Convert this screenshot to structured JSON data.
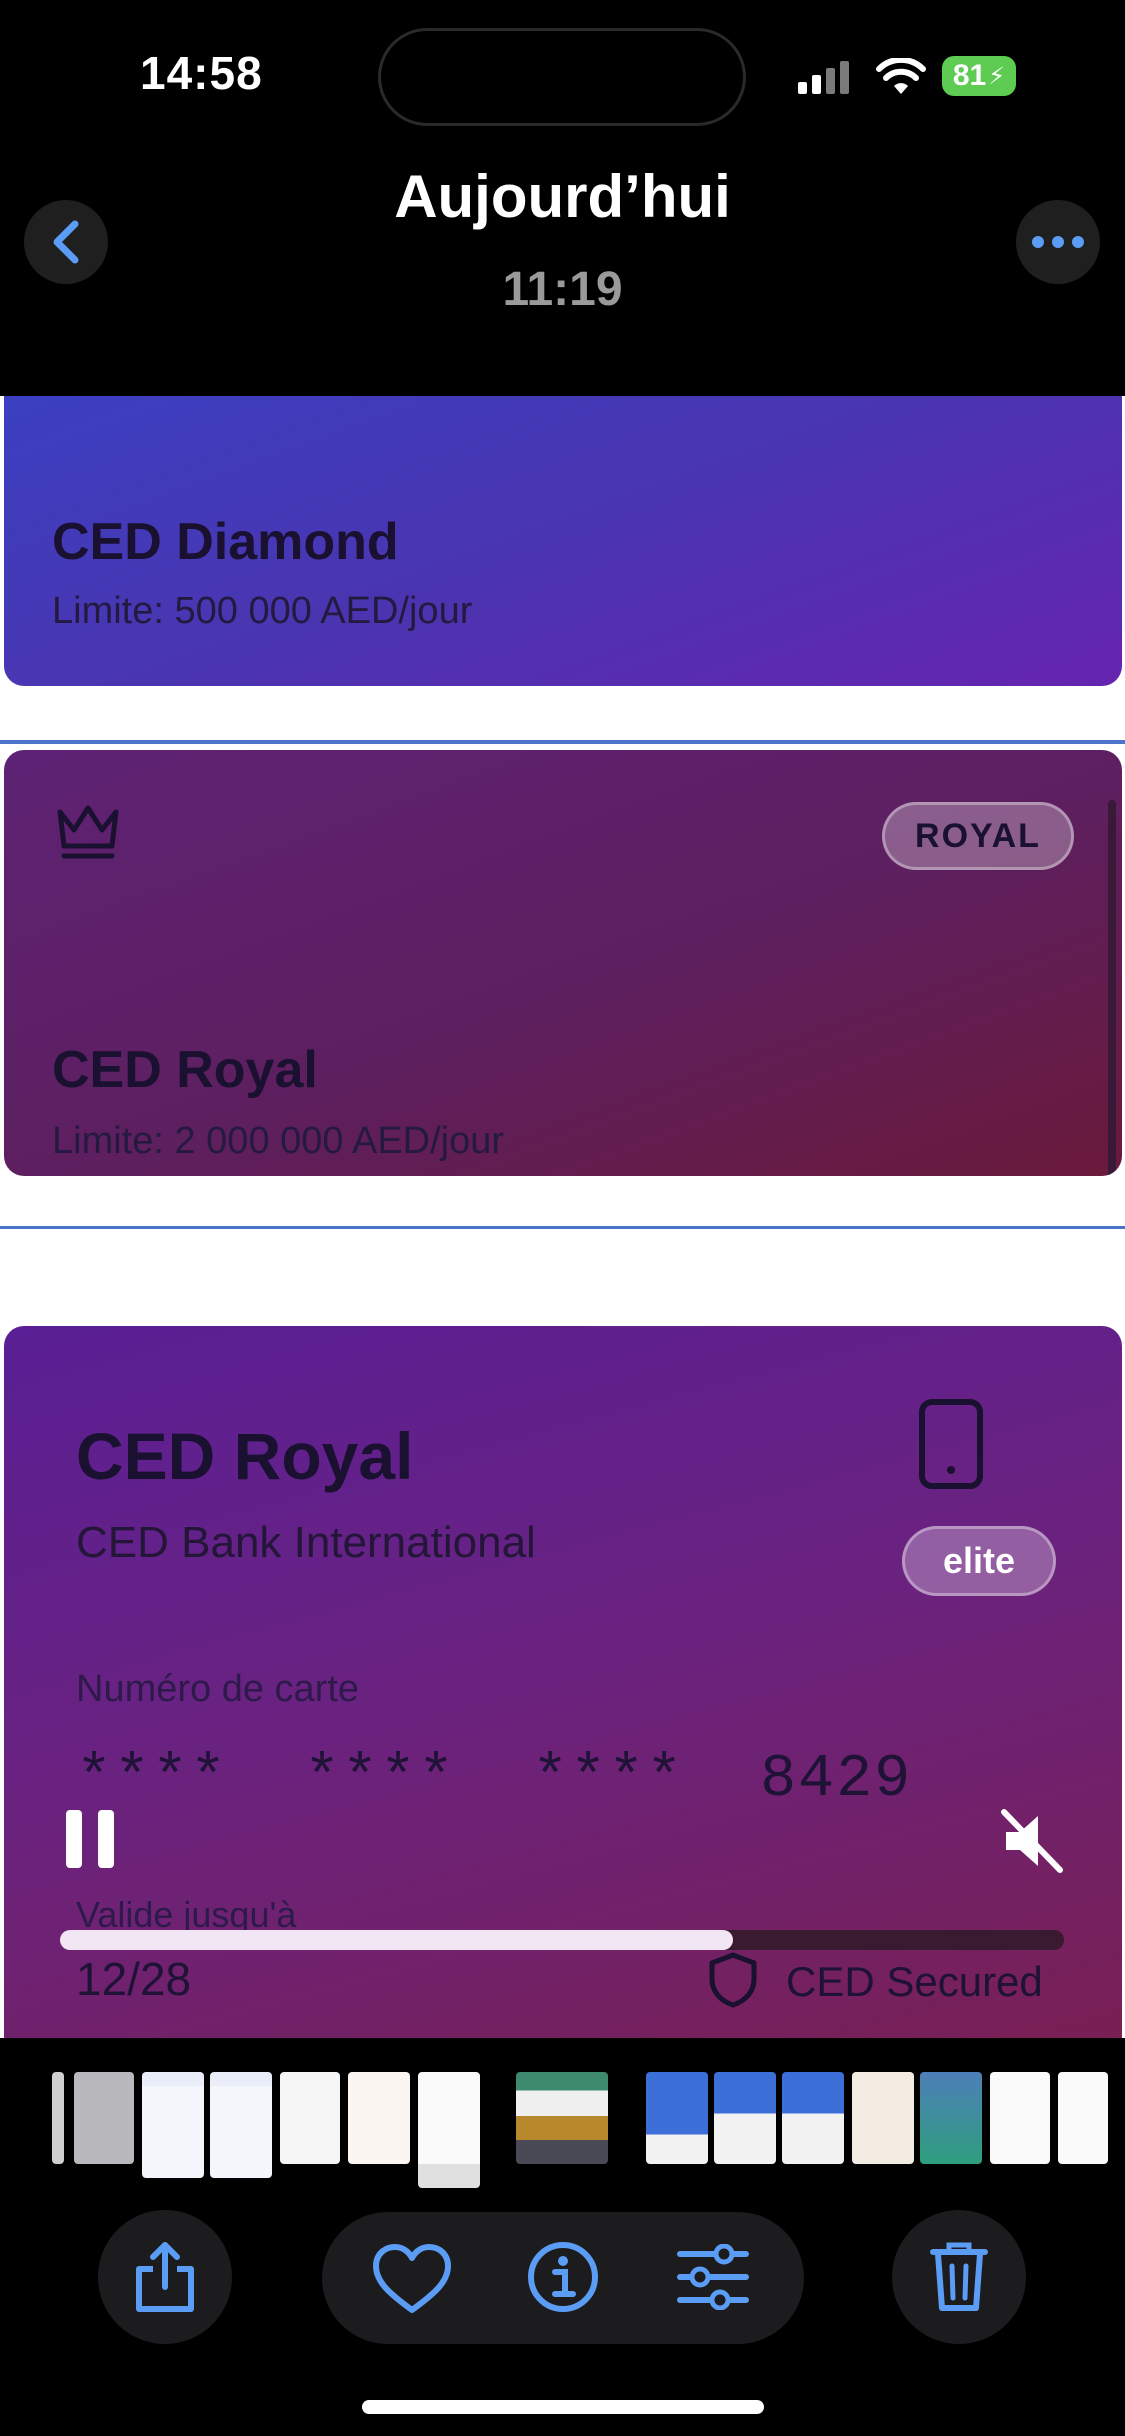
{
  "status_bar": {
    "time": "14:58",
    "battery": "81"
  },
  "header": {
    "title": "Aujourd’hui",
    "subtitle": "11:19"
  },
  "cards": [
    {
      "name": "CED Diamond",
      "limit": "Limite: 500 000 AED/jour"
    },
    {
      "name": "CED Royal",
      "limit": "Limite: 2 000 000 AED/jour",
      "badge": "ROYAL",
      "icon": "crown-icon"
    }
  ],
  "detail_card": {
    "title": "CED Royal",
    "bank": "CED Bank International",
    "badge": "elite",
    "number_label": "Numéro de carte",
    "number": "****  ****  ****  8429",
    "valid_label": "Valide jusqu'à",
    "valid": "12/28",
    "secured": "CED Secured"
  },
  "video": {
    "progress": 0.67
  },
  "colors": {
    "accent": "#5b9cf5",
    "battery": "#5ecb52"
  }
}
